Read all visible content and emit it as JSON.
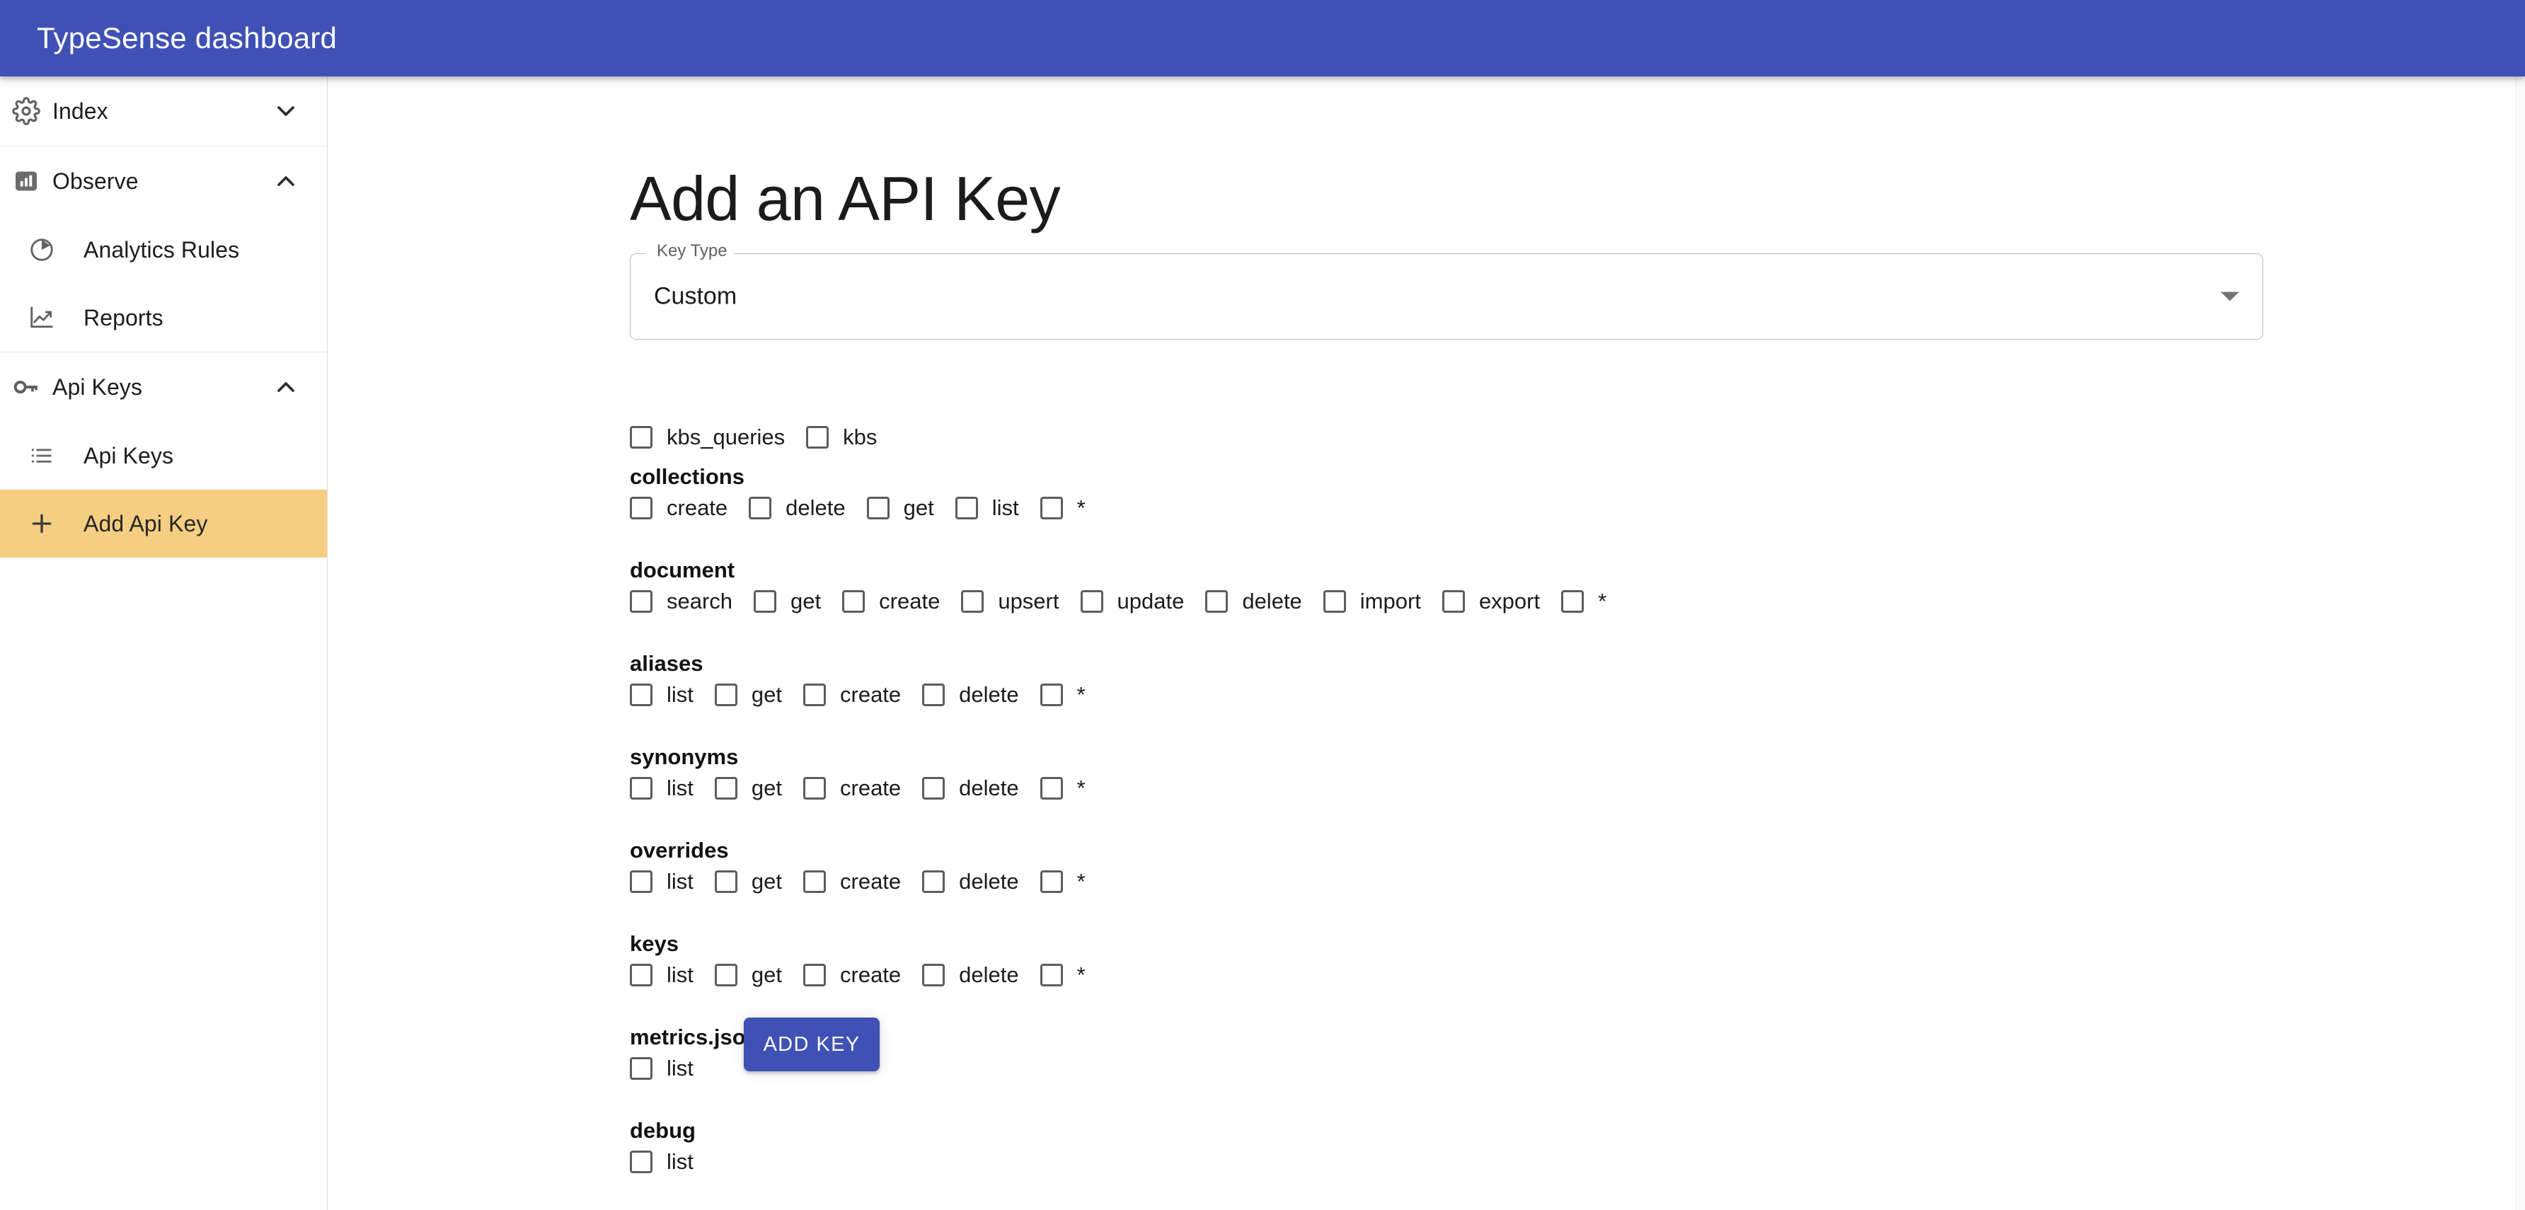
{
  "appbar": {
    "title": "TypeSense dashboard",
    "background_color": "#3f51b5",
    "text_color": "#ffffff"
  },
  "sidebar": {
    "groups": [
      {
        "header": {
          "label": "Index",
          "icon": "gear-icon",
          "chevron": "chevron-down-icon",
          "expanded": false
        },
        "children": []
      },
      {
        "header": {
          "label": "Observe",
          "icon": "bar-chart-icon",
          "chevron": "chevron-up-icon",
          "expanded": true
        },
        "children": [
          {
            "label": "Analytics Rules",
            "icon": "pie-chart-icon",
            "active": false
          },
          {
            "label": "Reports",
            "icon": "trending-up-icon",
            "active": false
          }
        ]
      },
      {
        "header": {
          "label": "Api Keys",
          "icon": "key-icon",
          "chevron": "chevron-up-icon",
          "expanded": true
        },
        "children": [
          {
            "label": "Api Keys",
            "icon": "list-icon",
            "active": false
          },
          {
            "label": "Add Api Key",
            "icon": "plus-icon",
            "active": true
          }
        ]
      }
    ],
    "active_highlight_color": "#f6ce82"
  },
  "main": {
    "page_title": "Add an API Key",
    "key_type_field": {
      "label": "Key Type",
      "value": "Custom",
      "arrow_icon": "chevron-down-icon",
      "options": [
        "Custom"
      ]
    },
    "collection_checkboxes": [
      {
        "label": "kbs_queries",
        "checked": false
      },
      {
        "label": "kbs",
        "checked": false
      }
    ],
    "permission_groups": [
      {
        "name": "collections",
        "actions": [
          {
            "label": "create",
            "checked": false
          },
          {
            "label": "delete",
            "checked": false
          },
          {
            "label": "get",
            "checked": false
          },
          {
            "label": "list",
            "checked": false
          },
          {
            "label": "*",
            "checked": false
          }
        ]
      },
      {
        "name": "document",
        "actions": [
          {
            "label": "search",
            "checked": false
          },
          {
            "label": "get",
            "checked": false
          },
          {
            "label": "create",
            "checked": false
          },
          {
            "label": "upsert",
            "checked": false
          },
          {
            "label": "update",
            "checked": false
          },
          {
            "label": "delete",
            "checked": false
          },
          {
            "label": "import",
            "checked": false
          },
          {
            "label": "export",
            "checked": false
          },
          {
            "label": "*",
            "checked": false
          }
        ]
      },
      {
        "name": "aliases",
        "actions": [
          {
            "label": "list",
            "checked": false
          },
          {
            "label": "get",
            "checked": false
          },
          {
            "label": "create",
            "checked": false
          },
          {
            "label": "delete",
            "checked": false
          },
          {
            "label": "*",
            "checked": false
          }
        ]
      },
      {
        "name": "synonyms",
        "actions": [
          {
            "label": "list",
            "checked": false
          },
          {
            "label": "get",
            "checked": false
          },
          {
            "label": "create",
            "checked": false
          },
          {
            "label": "delete",
            "checked": false
          },
          {
            "label": "*",
            "checked": false
          }
        ]
      },
      {
        "name": "overrides",
        "actions": [
          {
            "label": "list",
            "checked": false
          },
          {
            "label": "get",
            "checked": false
          },
          {
            "label": "create",
            "checked": false
          },
          {
            "label": "delete",
            "checked": false
          },
          {
            "label": "*",
            "checked": false
          }
        ]
      },
      {
        "name": "keys",
        "actions": [
          {
            "label": "list",
            "checked": false
          },
          {
            "label": "get",
            "checked": false
          },
          {
            "label": "create",
            "checked": false
          },
          {
            "label": "delete",
            "checked": false
          },
          {
            "label": "*",
            "checked": false
          }
        ]
      },
      {
        "name": "metrics.json",
        "actions": [
          {
            "label": "list",
            "checked": false
          }
        ]
      },
      {
        "name": "debug",
        "actions": [
          {
            "label": "list",
            "checked": false
          }
        ]
      }
    ],
    "submit_button": {
      "label": "ADD KEY",
      "color": "#3f51b5",
      "text_color": "#ffffff"
    }
  }
}
